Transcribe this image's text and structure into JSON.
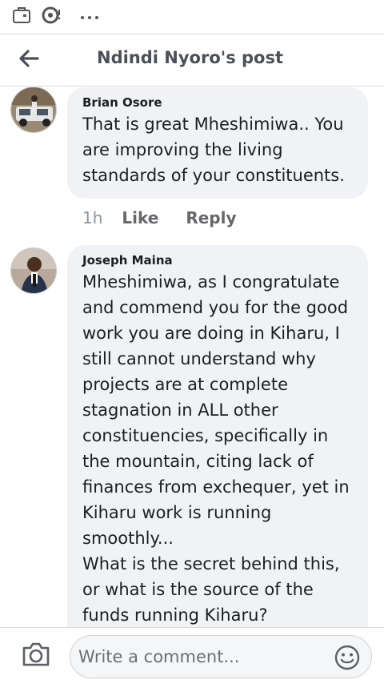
{
  "header": {
    "title": "Ndindi Nyoro's post"
  },
  "comments": [
    {
      "author": "Brian Osore",
      "text": "That is great Mheshimiwa.. You are improving the living standards of your constituents.",
      "time": "1h",
      "like_label": "Like",
      "reply_label": "Reply"
    },
    {
      "author": "Joseph Maina",
      "text": "Mheshimiwa, as I congratulate and commend you for the good work you are doing in Kiharu, I still cannot understand why projects are at complete stagnation in ALL other constituencies, specifically in the mountain, citing lack of finances from exchequer, yet in Kiharu work is running smoothly...\nWhat is the secret behind this, or what is the source of the funds running Kiharu?"
    }
  ],
  "composer": {
    "placeholder": "Write a comment..."
  },
  "icons": {
    "statusbar": [
      "briefcase-icon",
      "cloud-sync-icon",
      "more-dots-icon"
    ],
    "header": "back-arrow-icon",
    "composer": [
      "camera-icon",
      "emoji-icon"
    ]
  },
  "colors": {
    "bubble": "#f1f2f6",
    "title": "#4b4f56",
    "action": "#65676b"
  }
}
